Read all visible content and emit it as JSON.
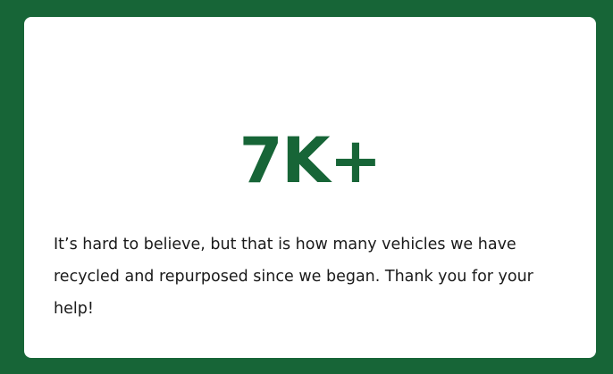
{
  "colors": {
    "background": "#176537",
    "card": "#ffffff",
    "accent": "#176537",
    "text": "#1a1a1a"
  },
  "stat_card": {
    "value": "7K+",
    "description": "It’s hard to believe, but that is how many vehicles we have recycled and repurposed since we began. Thank you for your help!"
  }
}
